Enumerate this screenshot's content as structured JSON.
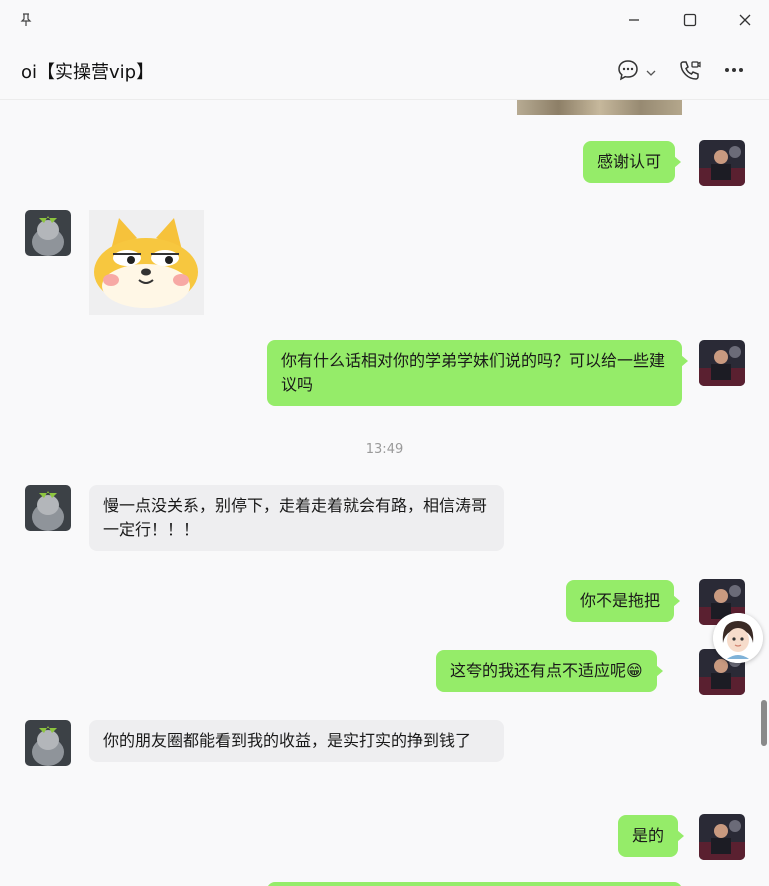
{
  "window": {
    "pin_icon": "pin-icon",
    "minimize_icon": "minimize-icon",
    "maximize_icon": "maximize-icon",
    "close_icon": "close-icon"
  },
  "header": {
    "title": "oi【实操营vip】",
    "icons": [
      "chat-bubble-icon",
      "chevron-down-icon",
      "voice-video-call-icon",
      "more-icon"
    ]
  },
  "messages": [
    {
      "sender": "self",
      "type": "image",
      "note": ""
    },
    {
      "sender": "self",
      "type": "text",
      "text": "感谢认可"
    },
    {
      "sender": "other",
      "type": "sticker"
    },
    {
      "sender": "self",
      "type": "text",
      "text": "你有什么话相对你的学弟学妹们说的吗？可以给一些建议吗"
    },
    {
      "type": "time",
      "text": "13:49"
    },
    {
      "sender": "other",
      "type": "text",
      "text": "慢一点没关系，别停下，走着走着就会有路，相信涛哥一定行！！！"
    },
    {
      "sender": "self",
      "type": "text",
      "text": "你不是拖把"
    },
    {
      "sender": "self",
      "type": "text",
      "text": "这夸的我还有点不适应呢😁"
    },
    {
      "sender": "other",
      "type": "text",
      "text": "你的朋友圈都能看到我的收益，是实打实的挣到钱了"
    },
    {
      "sender": "self",
      "type": "text",
      "text": "是的"
    }
  ],
  "colors": {
    "self_bubble": "#95ec69",
    "other_bubble": "#eeeef0",
    "background": "#f9f9fa"
  }
}
